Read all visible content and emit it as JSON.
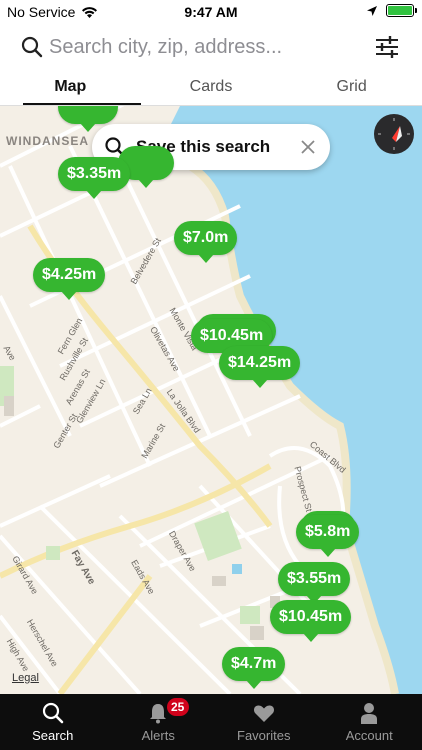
{
  "status_bar": {
    "carrier": "No Service",
    "time": "9:47 AM",
    "battery_level": 1.0,
    "battery_color": "#32c341"
  },
  "search": {
    "placeholder": "Search city, zip, address...",
    "search_icon": "search-icon",
    "filter_icon": "sliders-icon"
  },
  "view_tabs": [
    {
      "label": "Map",
      "active": true
    },
    {
      "label": "Cards",
      "active": false
    },
    {
      "label": "Grid",
      "active": false
    }
  ],
  "map": {
    "area_label": "WINDANSEA",
    "save_search_label": "Save this search",
    "legal_label": "Legal",
    "pin_color": "#36b630",
    "water_color": "#9dd7f0",
    "street_labels": [
      "Belvedere St",
      "Fern Glen",
      "Rushville St",
      "Arenas St",
      "Glenview Ln",
      "Genter St",
      "Olivetas Ave",
      "Monte Vista",
      "Sea Ln",
      "La Jolla Blvd",
      "Marine St",
      "Coast Blvd",
      "Prospect St",
      "Draper Ave",
      "Eads Ave",
      "Fay Ave",
      "Girard Ave",
      "Herschel Ave",
      "High Ave",
      "Ave"
    ],
    "price_pins": [
      "$3.35m",
      "$7.0m",
      "$4.25m",
      "$10.45m",
      "$14.25m",
      "$5.8m",
      "$3.55m",
      "$10.45m",
      "$4.7m"
    ]
  },
  "bottom_tabs": [
    {
      "label": "Search",
      "icon": "search-icon",
      "active": true
    },
    {
      "label": "Alerts",
      "icon": "bell-icon",
      "active": false,
      "badge": "25"
    },
    {
      "label": "Favorites",
      "icon": "heart-icon",
      "active": false
    },
    {
      "label": "Account",
      "icon": "person-icon",
      "active": false
    }
  ]
}
